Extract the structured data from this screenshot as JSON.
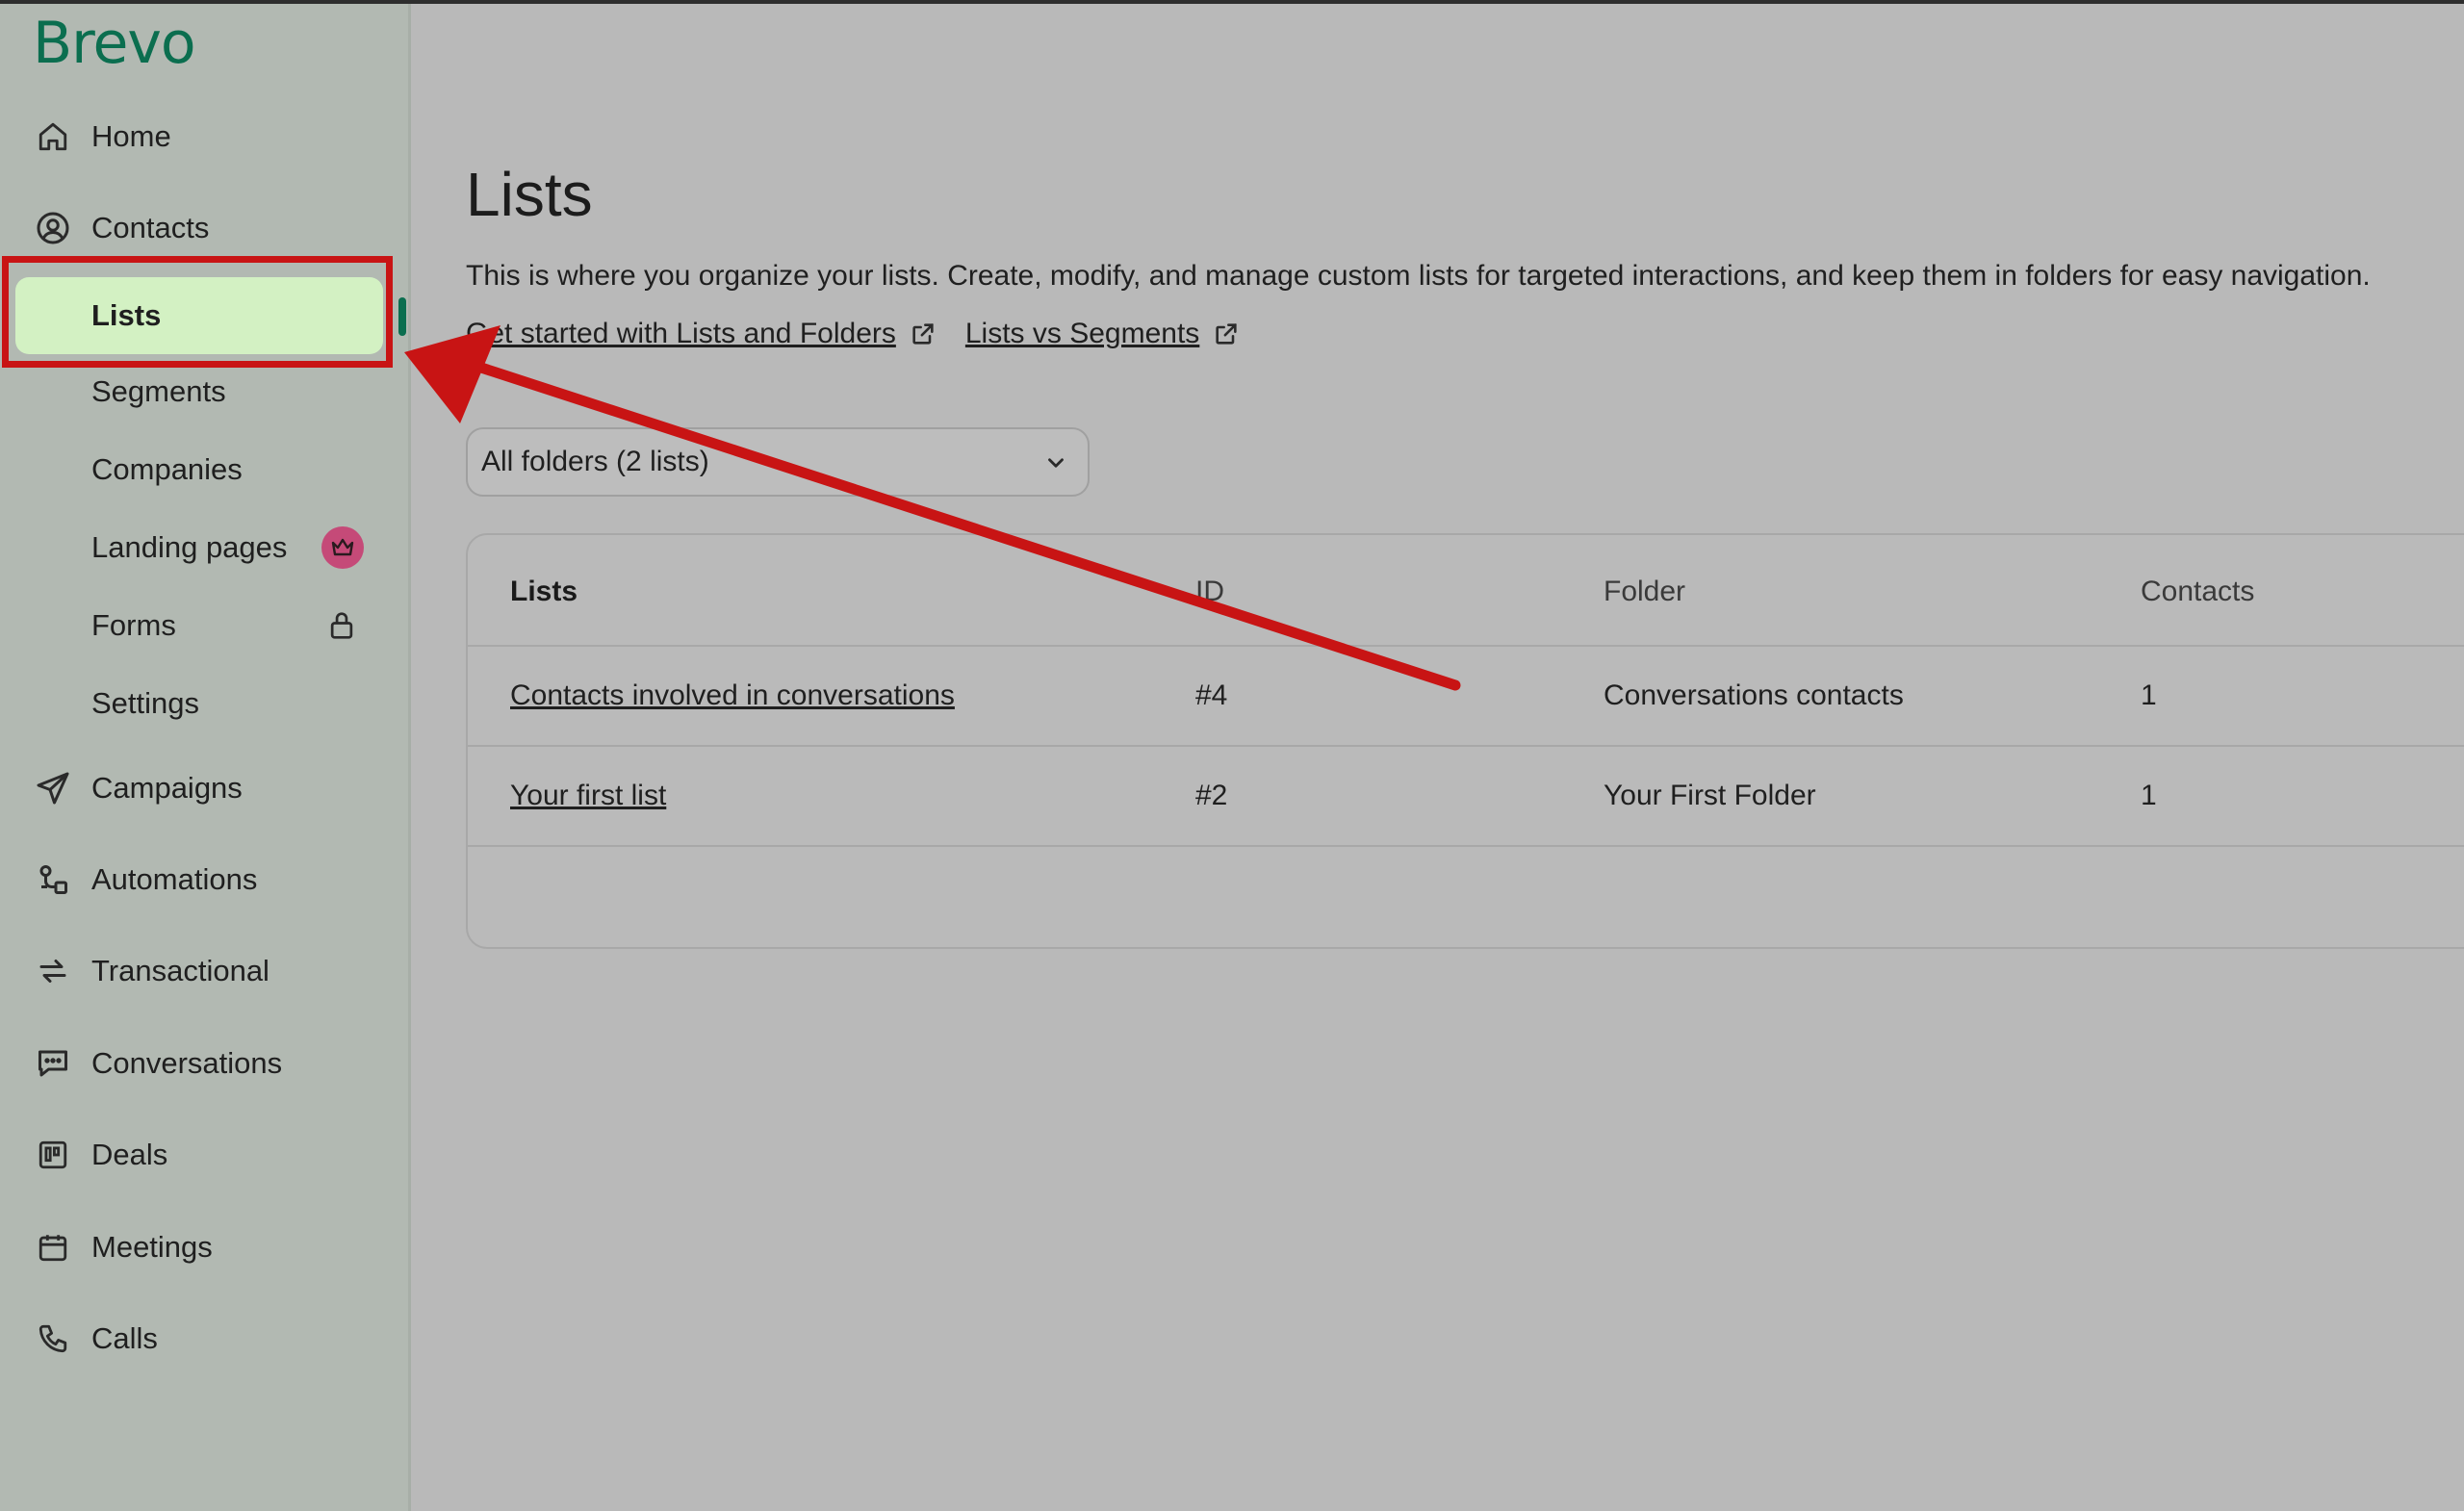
{
  "brand": {
    "logo_text": "Brevo",
    "accent_color": "#0b6e4f"
  },
  "sidebar": {
    "items": [
      {
        "label": "Home",
        "icon": "home-icon"
      },
      {
        "label": "Contacts",
        "icon": "contacts-icon"
      },
      {
        "label": "Campaigns",
        "icon": "send-icon"
      },
      {
        "label": "Automations",
        "icon": "automation-icon"
      },
      {
        "label": "Transactional",
        "icon": "transactional-icon"
      },
      {
        "label": "Conversations",
        "icon": "chat-icon"
      },
      {
        "label": "Deals",
        "icon": "deals-icon"
      },
      {
        "label": "Meetings",
        "icon": "calendar-icon"
      },
      {
        "label": "Calls",
        "icon": "phone-icon"
      }
    ],
    "contacts_subitems": [
      {
        "label": "Lists",
        "active": true
      },
      {
        "label": "Segments"
      },
      {
        "label": "Companies"
      },
      {
        "label": "Landing pages",
        "badge_icon": "crown-icon",
        "badge_color": "#c54a78"
      },
      {
        "label": "Forms",
        "badge_icon": "lock-icon"
      },
      {
        "label": "Settings"
      }
    ]
  },
  "main": {
    "title": "Lists",
    "description": "This is where you organize your lists. Create, modify, and manage custom lists for targeted interactions, and keep them in folders for easy navigation.",
    "help_links": [
      {
        "label": "Get started with Lists and Folders",
        "icon": "external-link-icon"
      },
      {
        "label": "Lists vs Segments",
        "icon": "external-link-icon"
      }
    ],
    "folder_filter": {
      "selected": "All folders (2 lists)"
    },
    "table": {
      "columns": [
        "Lists",
        "ID",
        "Folder",
        "Contacts"
      ],
      "rows": [
        {
          "name": "Contacts involved in conversations",
          "id": "#4",
          "folder": "Conversations contacts",
          "contacts": "1"
        },
        {
          "name": "Your first list",
          "id": "#2",
          "folder": "Your First Folder",
          "contacts": "1"
        }
      ]
    }
  },
  "annotation": {
    "color": "#c81414",
    "highlight_target": "Lists",
    "arrow": "red-arrow"
  }
}
